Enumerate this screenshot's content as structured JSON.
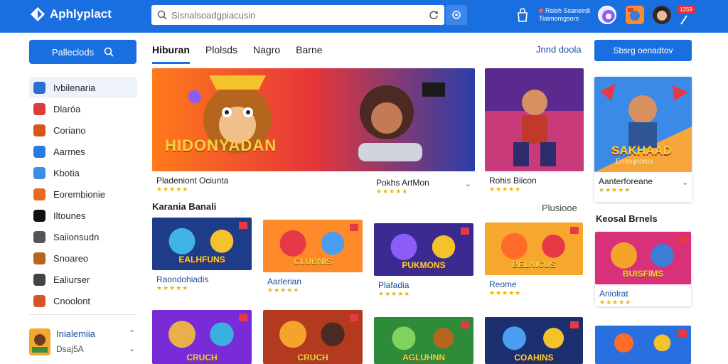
{
  "header": {
    "app_title": "Aphlyplact",
    "search_placeholder": "Sisnalsoadgpiacusin",
    "notification_line1": "Rsioh Ssaneirdi",
    "notification_line2": "Tiaimomgsors",
    "badge": "1259"
  },
  "sidebar": {
    "primary_button": "Palleclods",
    "items": [
      {
        "label": "Ivbilenaria",
        "icon": "home-icon",
        "color": "#2b6fd6"
      },
      {
        "label": "Dlaróa",
        "icon": "video-icon",
        "color": "#e03a3a"
      },
      {
        "label": "Coriano",
        "icon": "game-icon",
        "color": "#d9541a"
      },
      {
        "label": "Aarmes",
        "icon": "chat-icon",
        "color": "#2a7be0"
      },
      {
        "label": "Kbotia",
        "icon": "globe-icon",
        "color": "#3b8de5"
      },
      {
        "label": "Eorembionie",
        "icon": "gift-icon",
        "color": "#e86a1c"
      },
      {
        "label": "Iltounes",
        "icon": "circle-b-icon",
        "color": "#111111"
      },
      {
        "label": "Saiionsudn",
        "icon": "refresh-icon",
        "color": "#555555"
      },
      {
        "label": "Snoareo",
        "icon": "character-icon",
        "color": "#b5651d"
      },
      {
        "label": "Ealiurser",
        "icon": "document-icon",
        "color": "#444444"
      },
      {
        "label": "Cnoolont",
        "icon": "user-icon",
        "color": "#d4552b"
      }
    ],
    "footer_title": "Inialemiia",
    "footer_subtitle": "Dsaj5A"
  },
  "tabs": [
    {
      "label": "Hiburan",
      "active": true
    },
    {
      "label": "Plolsds",
      "active": false
    },
    {
      "label": "Nagro",
      "active": false
    },
    {
      "label": "Barne",
      "active": false
    }
  ],
  "tab_link": "Jnnd doola",
  "cta_button": "Sbsrg oenadtov",
  "featured": [
    {
      "caption": "Pladeniont Ociunta",
      "art_text": "HIDONYADAN"
    },
    {
      "caption": "Pokhs ArtMon",
      "art_text": ""
    },
    {
      "caption": "Rohis Biicon",
      "art_text": ""
    },
    {
      "caption": "Aanterforeane",
      "art_text": "SAKHAAD",
      "art_sub": "Ennoijnorus"
    }
  ],
  "section_left": {
    "title": "Karania Banali",
    "link": "Plusiooe"
  },
  "section_right": {
    "title": "Keosal Brnels"
  },
  "grid": [
    {
      "caption": "Raondohiadis",
      "art_text": "EALHFUNS"
    },
    {
      "caption": "Aarlerian",
      "art_text": "CLUBNIS"
    },
    {
      "caption": "Plafadia",
      "art_text": "PUKMONS"
    },
    {
      "caption": "Reome",
      "art_text": "BELNICUS"
    },
    {
      "caption": "Aniolrat",
      "art_text": "BUISFIMS"
    }
  ],
  "grid_row2": [
    {
      "art_text": "CRUCH"
    },
    {
      "art_text": "CRUCH"
    },
    {
      "art_text": "AGLUHNN"
    },
    {
      "art_text": "COAHINS"
    },
    {
      "art_text": ""
    }
  ],
  "rating_stars": "★★★★★"
}
